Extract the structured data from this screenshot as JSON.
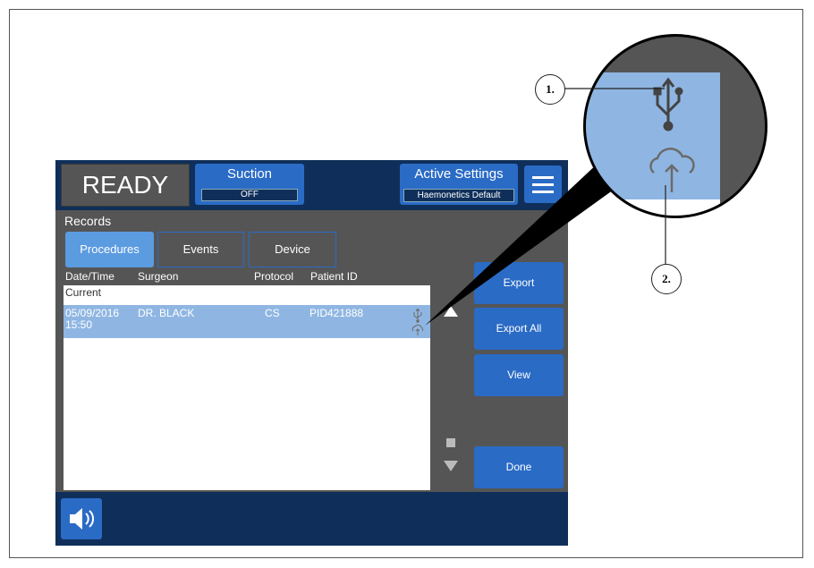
{
  "status": {
    "ready_label": "READY"
  },
  "suction": {
    "label": "Suction",
    "value": "OFF"
  },
  "active_settings": {
    "label": "Active Settings",
    "value": "Haemonetics Default"
  },
  "records": {
    "title": "Records",
    "tabs": [
      {
        "label": "Procedures",
        "active": true
      },
      {
        "label": "Events",
        "active": false
      },
      {
        "label": "Device",
        "active": false
      }
    ],
    "columns": [
      "Date/Time",
      "Surgeon",
      "Protocol",
      "Patient ID"
    ],
    "current_label": "Current",
    "rows": [
      {
        "date": "05/09/2016",
        "time": "15:50",
        "surgeon": "DR. BLACK",
        "protocol": "CS",
        "patient_id": "PID421888",
        "icons": [
          "usb-icon",
          "cloud-upload-icon"
        ]
      }
    ]
  },
  "actions": {
    "export": "Export",
    "export_all": "Export All",
    "view": "View",
    "done": "Done"
  },
  "callouts": {
    "one": "1.",
    "two": "2."
  },
  "colors": {
    "navy": "#0f2f5a",
    "blue": "#2a6bc5",
    "selected_row": "#8fb6e2",
    "panel_gray": "#555555"
  }
}
